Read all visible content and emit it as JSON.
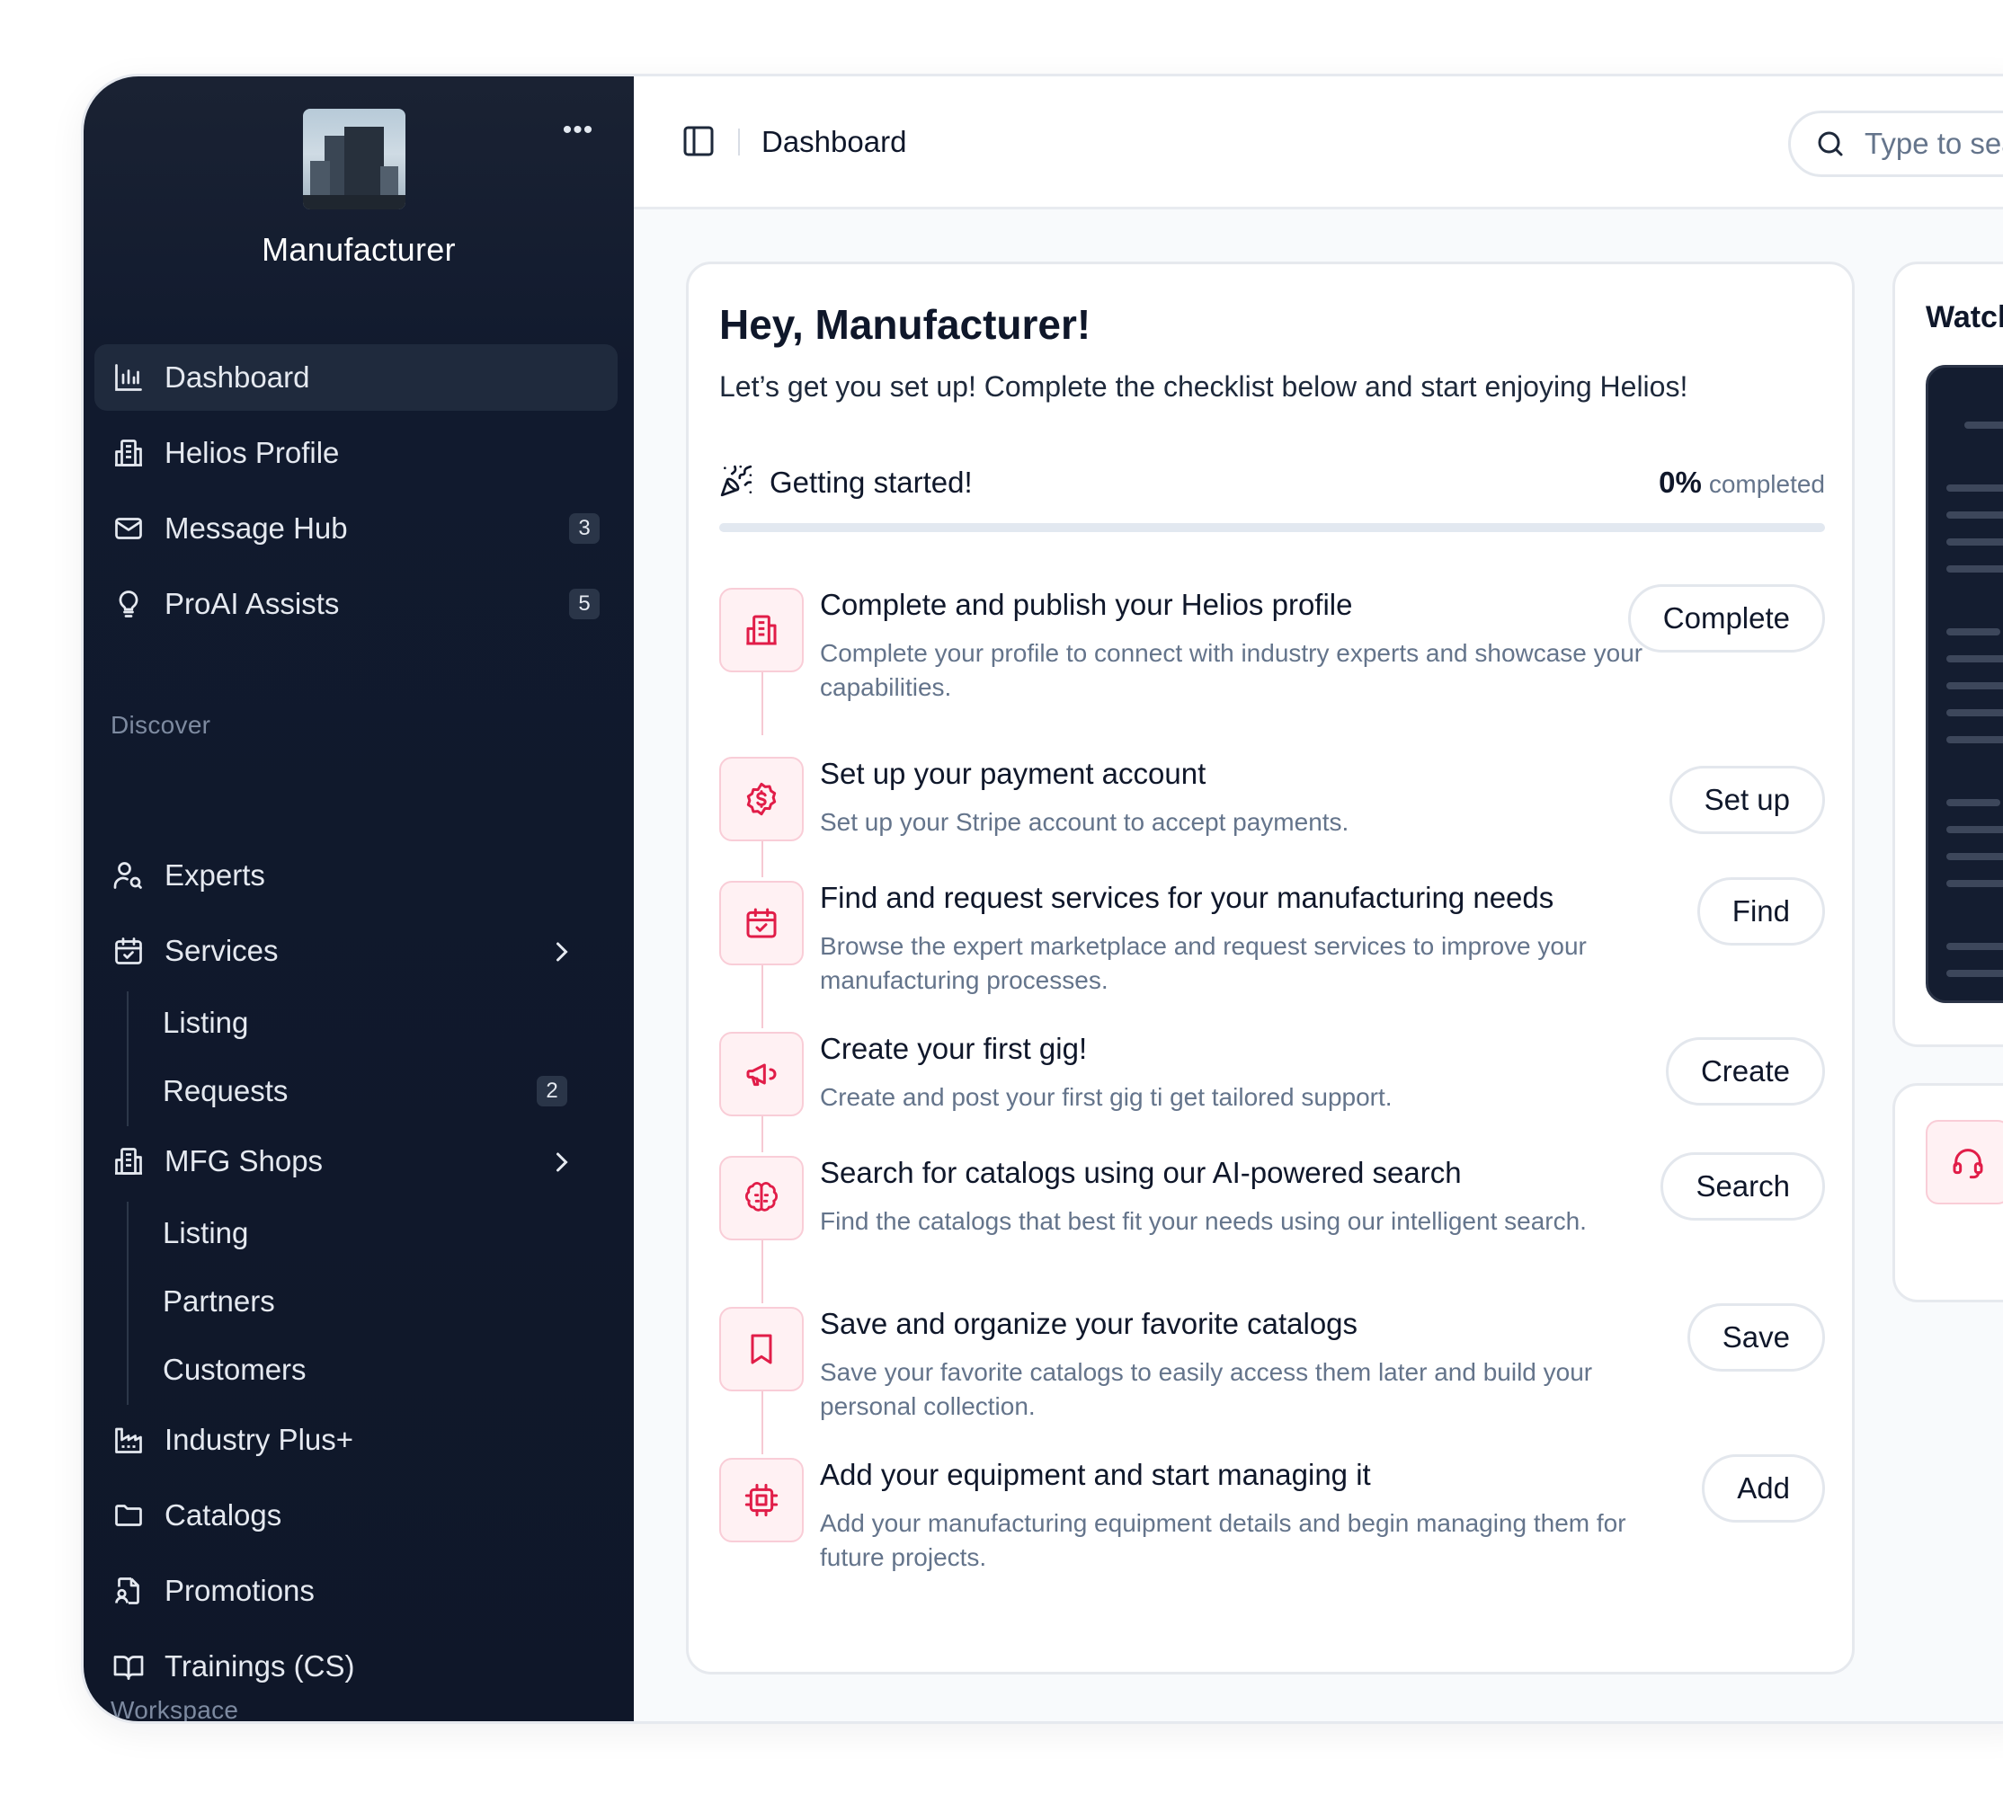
{
  "sidebar": {
    "brand_name": "Manufacturer",
    "more_label": "•••",
    "nav": [
      {
        "label": "Dashboard",
        "icon": "bar-chart-icon",
        "active": true
      },
      {
        "label": "Helios Profile",
        "icon": "building-icon"
      },
      {
        "label": "Message Hub",
        "icon": "mail-icon",
        "badge": "3"
      },
      {
        "label": "ProAI Assists",
        "icon": "lightbulb-icon",
        "badge": "5"
      }
    ],
    "discover_label": "Discover",
    "discover": [
      {
        "label": "Experts",
        "icon": "user-search-icon"
      },
      {
        "label": "Services",
        "icon": "calendar-check-icon",
        "children": [
          {
            "label": "Listing"
          },
          {
            "label": "Requests",
            "badge": "2"
          }
        ]
      },
      {
        "label": "MFG Shops",
        "icon": "building-icon",
        "children": [
          {
            "label": "Listing"
          },
          {
            "label": "Partners"
          },
          {
            "label": "Customers"
          }
        ]
      },
      {
        "label": "Industry Plus+",
        "icon": "factory-icon"
      },
      {
        "label": "Catalogs",
        "icon": "folder-icon"
      },
      {
        "label": "Promotions",
        "icon": "file-person-icon"
      },
      {
        "label": "Trainings (CS)",
        "icon": "book-open-icon"
      }
    ],
    "workspace_label": "Workspace"
  },
  "topbar": {
    "title": "Dashboard",
    "search_placeholder": "Type to search"
  },
  "checklist": {
    "greeting": "Hey, Manufacturer!",
    "intro": "Let’s get you set up! Complete the checklist below and start enjoying Helios!",
    "section_title": "Getting started!",
    "percent_label": "0%",
    "completed_label": "completed",
    "progress": 0,
    "accent": "#e11d48",
    "steps": [
      {
        "title": "Complete and publish your Helios profile",
        "desc": "Complete your profile to connect with industry experts and showcase your capabilities.",
        "button": "Complete",
        "icon": "building-icon"
      },
      {
        "title": "Set up your payment account",
        "desc": "Set up your Stripe account to accept payments.",
        "button": "Set up",
        "icon": "dollar-badge-icon"
      },
      {
        "title": "Find and request services for your manufacturing needs",
        "desc": "Browse the expert marketplace and request services to improve your manufacturing processes.",
        "button": "Find",
        "icon": "calendar-check-icon"
      },
      {
        "title": "Create your first gig!",
        "desc": "Create and post your first gig ti get tailored support.",
        "button": "Create",
        "icon": "megaphone-icon"
      },
      {
        "title": "Search for catalogs using our AI-powered search",
        "desc": "Find the catalogs that best fit your needs using our intelligent search.",
        "button": "Search",
        "icon": "brain-icon"
      },
      {
        "title": "Save and organize your favorite catalogs",
        "desc": "Save your favorite catalogs to easily access them later and build your personal collection.",
        "button": "Save",
        "icon": "bookmark-icon"
      },
      {
        "title": "Add your equipment and start managing it",
        "desc": "Add your manufacturing equipment details and begin managing them for future projects.",
        "button": "Add",
        "icon": "cpu-icon"
      }
    ]
  },
  "watch": {
    "title": "Watch"
  },
  "support": {
    "icon": "headset-icon"
  }
}
